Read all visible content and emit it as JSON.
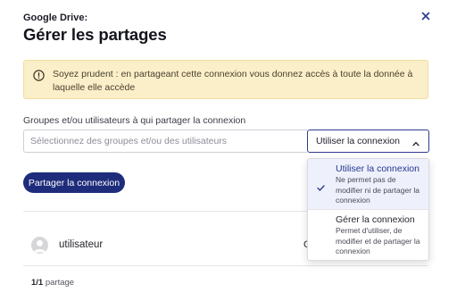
{
  "header": {
    "subtitle": "Google Drive:",
    "title": "Gérer les partages",
    "close_icon": "close-icon"
  },
  "warning": {
    "icon": "alert-circle-icon",
    "text": "Soyez prudent : en partageant cette connexion vous donnez accès à toute la donnée à laquelle elle accède",
    "colors": {
      "background": "#fbefc9",
      "border": "#f1dda1"
    }
  },
  "share_form": {
    "label": "Groupes et/ou utilisateurs à qui partager la connexion",
    "search_placeholder": "Sélectionnez des groupes et/ou des utilisateurs",
    "permission_select": {
      "value": "Utiliser la connexion",
      "expanded": true,
      "options": [
        {
          "title": "Utiliser la connexion",
          "description": "Ne permet pas de modifier ni de partager la connexion",
          "selected": true
        },
        {
          "title": "Gérer la connexion",
          "description": "Permet d'utiliser, de modifier et de partager la connexion",
          "selected": false
        }
      ]
    },
    "share_button": "Partager la connexion"
  },
  "shares": {
    "users": [
      {
        "name": "utilisateur",
        "role_visible": "G"
      }
    ],
    "count_bold": "1/1",
    "count_label": " partage"
  },
  "colors": {
    "primary": "#1e2c7b",
    "selected_option_bg": "#eef1fb",
    "selected_option_text": "#26358f"
  }
}
